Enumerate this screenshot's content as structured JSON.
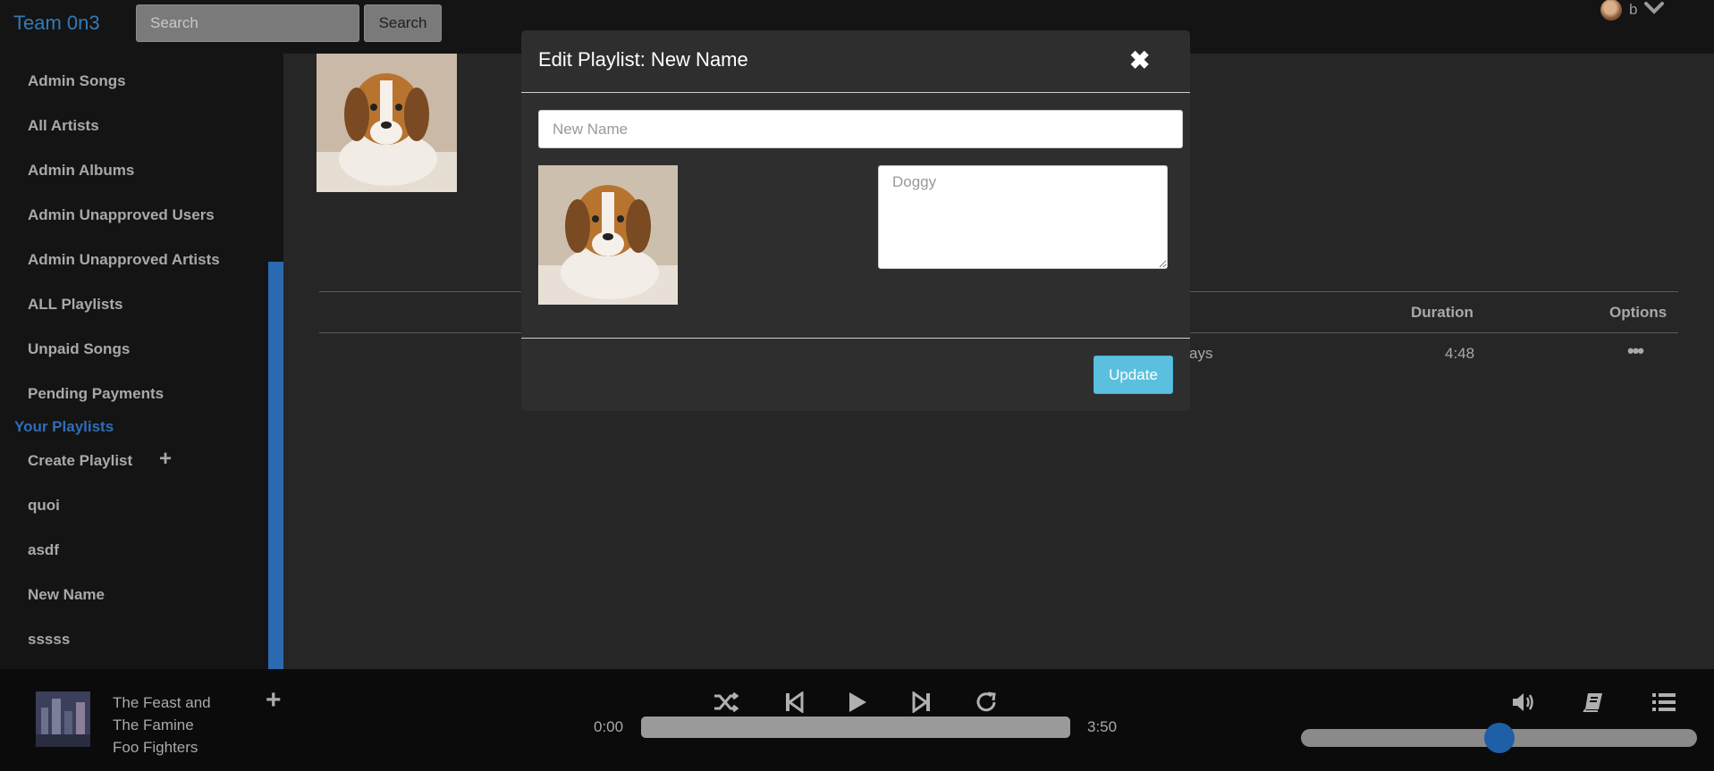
{
  "app": {
    "brand": "Team 0n3"
  },
  "search": {
    "placeholder": "Search",
    "button_label": "Search"
  },
  "user": {
    "name": "b"
  },
  "sidebar": {
    "items": [
      "Admin Songs",
      "All Artists",
      "Admin Albums",
      "Admin Unapproved Users",
      "Admin Unapproved Artists",
      "ALL Playlists",
      "Unpaid Songs",
      "Pending Payments"
    ],
    "playlists_heading": "Your Playlists",
    "create_playlist": "Create Playlist",
    "playlists": [
      "quoi",
      "asdf",
      "New Name",
      "sssss"
    ]
  },
  "table": {
    "headers": {
      "duration": "Duration",
      "options": "Options"
    },
    "rows": [
      {
        "title_fragment": "ays",
        "duration": "4:48"
      }
    ]
  },
  "modal": {
    "title": "Edit Playlist: New Name",
    "name_placeholder": "New Name",
    "description_placeholder": "Doggy",
    "update_label": "Update"
  },
  "player": {
    "now_playing": [
      "The Feast and",
      "The Famine",
      "Foo Fighters"
    ],
    "current_time": "0:00",
    "total_time": "3:50",
    "progress": 0,
    "volume": 0.5
  },
  "icons": {
    "close": "close-icon",
    "add": "plus-icon",
    "shuffle": "shuffle-icon",
    "previous": "skip-back-icon",
    "play": "play-icon",
    "next": "skip-forward-icon",
    "repeat": "repeat-icon",
    "volume": "volume-icon",
    "lyrics": "book-icon",
    "queue": "queue-list-icon",
    "options": "more-dots-icon"
  },
  "colors": {
    "brand": "#337ab7",
    "accent": "#2b6ab0",
    "update_button": "#5bc0de"
  }
}
